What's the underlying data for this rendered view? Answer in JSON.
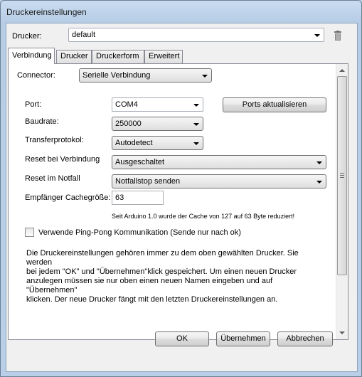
{
  "window": {
    "title": "Druckereinstellungen"
  },
  "printer": {
    "label": "Drucker:",
    "value": "default"
  },
  "tabs": [
    {
      "label": "Verbindung"
    },
    {
      "label": "Drucker"
    },
    {
      "label": "Druckerform"
    },
    {
      "label": "Erweitert"
    }
  ],
  "connection": {
    "connector_label": "Connector:",
    "connector_value": "Serielle Verbindung",
    "port_label": "Port:",
    "port_value": "COM4",
    "refresh_ports": "Ports aktualisieren",
    "baud_label": "Baudrate:",
    "baud_value": "250000",
    "protocol_label": "Transferprotokol:",
    "protocol_value": "Autodetect",
    "reset_connect_label": "Reset bei Verbindung",
    "reset_connect_value": "Ausgeschaltet",
    "reset_emergency_label": "Reset im Notfall",
    "reset_emergency_value": "Notfallstop senden",
    "cache_label": "Empfänger Cachegröße:",
    "cache_value": "63",
    "cache_note": "Seit Arduino 1.0 wurde der Cache von 127 auf 63 Byte reduziert!",
    "pingpong_label": "Verwende Ping-Pong Kommunikation (Sende nur nach ok)",
    "pingpong_checked": false,
    "description": [
      "Die Druckereinstellungen gehören immer zu dem oben gewählten Drucker. Sie werden",
      "bei jedem \"OK\" und \"Übernehmen\"klick gespeichert. Um einen neuen Drucker",
      "anzulegen müssen sie nur oben einen neuen Namen eingeben und auf \"Übernehmen\"",
      "klicken. Der neue Drucker fängt mit den letzten Druckereinstellungen an."
    ]
  },
  "buttons": {
    "ok": "OK",
    "apply": "Übernehmen",
    "cancel": "Abbrechen"
  },
  "icons": {
    "delete": "trash-icon"
  }
}
